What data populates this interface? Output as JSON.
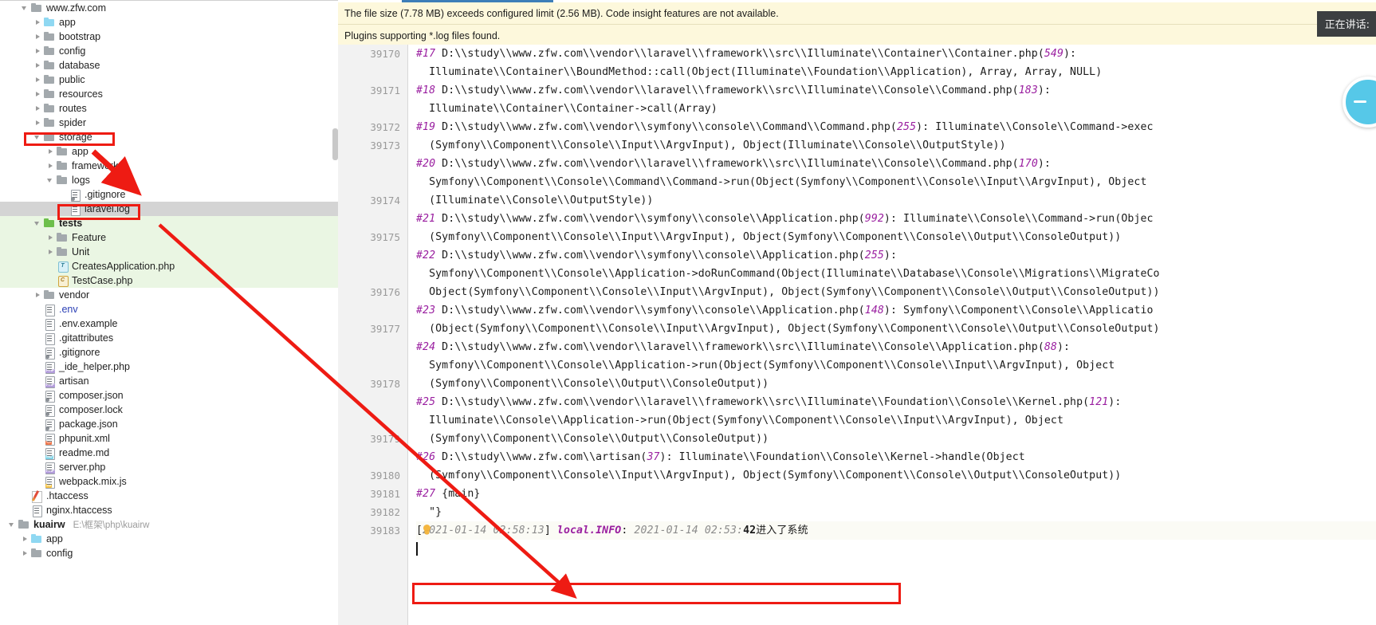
{
  "project_tree": {
    "rows": [
      {
        "indent": 0,
        "arrow": "open",
        "icon": "folder",
        "label": "www.zfw.com",
        "style": "normal"
      },
      {
        "indent": 1,
        "arrow": "closed",
        "icon": "folder-blue",
        "label": "app",
        "style": "normal"
      },
      {
        "indent": 1,
        "arrow": "closed",
        "icon": "folder",
        "label": "bootstrap",
        "style": "normal"
      },
      {
        "indent": 1,
        "arrow": "closed",
        "icon": "folder",
        "label": "config",
        "style": "normal"
      },
      {
        "indent": 1,
        "arrow": "closed",
        "icon": "folder",
        "label": "database",
        "style": "normal"
      },
      {
        "indent": 1,
        "arrow": "closed",
        "icon": "folder",
        "label": "public",
        "style": "normal"
      },
      {
        "indent": 1,
        "arrow": "closed",
        "icon": "folder",
        "label": "resources",
        "style": "normal"
      },
      {
        "indent": 1,
        "arrow": "closed",
        "icon": "folder",
        "label": "routes",
        "style": "normal"
      },
      {
        "indent": 1,
        "arrow": "closed",
        "icon": "folder",
        "label": "spider",
        "style": "normal"
      },
      {
        "indent": 1,
        "arrow": "open",
        "icon": "folder",
        "label": "storage",
        "style": "normal"
      },
      {
        "indent": 2,
        "arrow": "closed",
        "icon": "folder",
        "label": "app",
        "style": "normal"
      },
      {
        "indent": 2,
        "arrow": "closed",
        "icon": "folder",
        "label": "framework",
        "style": "normal"
      },
      {
        "indent": 2,
        "arrow": "open",
        "icon": "folder",
        "label": "logs",
        "style": "normal"
      },
      {
        "indent": 3,
        "arrow": "none",
        "icon": "file-cfg",
        "label": ".gitignore",
        "style": "normal"
      },
      {
        "indent": 3,
        "arrow": "none",
        "icon": "file",
        "label": "laravel.log",
        "style": "selected"
      },
      {
        "indent": 1,
        "arrow": "open",
        "icon": "folder-green",
        "label": "tests",
        "style": "bold-green"
      },
      {
        "indent": 2,
        "arrow": "closed",
        "icon": "folder",
        "label": "Feature",
        "style": "green"
      },
      {
        "indent": 2,
        "arrow": "closed",
        "icon": "folder",
        "label": "Unit",
        "style": "green"
      },
      {
        "indent": 2,
        "arrow": "none",
        "icon": "trait",
        "label": "CreatesApplication.php",
        "style": "green"
      },
      {
        "indent": 2,
        "arrow": "none",
        "icon": "class",
        "label": "TestCase.php",
        "style": "green"
      },
      {
        "indent": 1,
        "arrow": "closed",
        "icon": "folder",
        "label": "vendor",
        "style": "normal"
      },
      {
        "indent": 1,
        "arrow": "none",
        "icon": "file",
        "label": ".env",
        "style": "blue"
      },
      {
        "indent": 1,
        "arrow": "none",
        "icon": "file",
        "label": ".env.example",
        "style": "normal"
      },
      {
        "indent": 1,
        "arrow": "none",
        "icon": "file",
        "label": ".gitattributes",
        "style": "normal"
      },
      {
        "indent": 1,
        "arrow": "none",
        "icon": "file-cfg",
        "label": ".gitignore",
        "style": "normal"
      },
      {
        "indent": 1,
        "arrow": "none",
        "icon": "file-php",
        "label": "_ide_helper.php",
        "style": "normal"
      },
      {
        "indent": 1,
        "arrow": "none",
        "icon": "file-php",
        "label": "artisan",
        "style": "normal"
      },
      {
        "indent": 1,
        "arrow": "none",
        "icon": "file-cfg",
        "label": "composer.json",
        "style": "normal"
      },
      {
        "indent": 1,
        "arrow": "none",
        "icon": "file-cfg",
        "label": "composer.lock",
        "style": "normal"
      },
      {
        "indent": 1,
        "arrow": "none",
        "icon": "file-cfg",
        "label": "package.json",
        "style": "normal"
      },
      {
        "indent": 1,
        "arrow": "none",
        "icon": "file-xml",
        "label": "phpunit.xml",
        "style": "normal"
      },
      {
        "indent": 1,
        "arrow": "none",
        "icon": "file-md",
        "label": "readme.md",
        "style": "normal"
      },
      {
        "indent": 1,
        "arrow": "none",
        "icon": "file-php",
        "label": "server.php",
        "style": "normal"
      },
      {
        "indent": 1,
        "arrow": "none",
        "icon": "file-js",
        "label": "webpack.mix.js",
        "style": "normal"
      },
      {
        "indent": 0,
        "arrow": "none",
        "icon": "file-pen",
        "label": ".htaccess",
        "style": "normal"
      },
      {
        "indent": 0,
        "arrow": "none",
        "icon": "file",
        "label": "nginx.htaccess",
        "style": "normal"
      },
      {
        "indent": -1,
        "arrow": "open",
        "icon": "folder",
        "label": "kuairw",
        "style": "bold",
        "path": "E:\\框架\\php\\kuairw"
      },
      {
        "indent": 0,
        "arrow": "closed",
        "icon": "folder-blue",
        "label": "app",
        "style": "normal"
      },
      {
        "indent": 0,
        "arrow": "closed",
        "icon": "folder",
        "label": "config",
        "style": "normal"
      }
    ]
  },
  "notifications": [
    {
      "text": "The file size (7.78 MB) exceeds configured limit (2.56 MB). Code insight features are not available."
    },
    {
      "text": "Plugins supporting *.log files found."
    }
  ],
  "speaking_badge": {
    "label": "正在讲话:"
  },
  "editor": {
    "gutter_numbers": [
      "39170",
      "",
      "39171",
      "",
      "39172",
      "39173",
      "",
      "",
      "39174",
      "",
      "39175",
      "",
      "",
      "39176",
      "",
      "39177",
      "",
      "",
      "39178",
      "",
      "",
      "39179",
      "",
      "39180",
      "39181",
      "39182",
      "39183"
    ],
    "lines": [
      {
        "type": "frame",
        "frame": "#17",
        "text": " D:\\\\study\\\\www.zfw.com\\\\vendor\\\\laravel\\\\framework\\\\src\\\\Illuminate\\\\Container\\\\Container.php(",
        "paren": "549",
        "tail": "):"
      },
      {
        "type": "cont",
        "text": "  Illuminate\\\\Container\\\\BoundMethod::call(Object(Illuminate\\\\Foundation\\\\Application), Array, Array, NULL)"
      },
      {
        "type": "frame",
        "frame": "#18",
        "text": " D:\\\\study\\\\www.zfw.com\\\\vendor\\\\laravel\\\\framework\\\\src\\\\Illuminate\\\\Console\\\\Command.php(",
        "paren": "183",
        "tail": "):"
      },
      {
        "type": "cont",
        "text": "  Illuminate\\\\Container\\\\Container->call(Array)"
      },
      {
        "type": "frame",
        "frame": "#19",
        "text": " D:\\\\study\\\\www.zfw.com\\\\vendor\\\\symfony\\\\console\\\\Command\\\\Command.php(",
        "paren": "255",
        "tail": "): Illuminate\\\\Console\\\\Command->exec"
      },
      {
        "type": "cont",
        "text": "  (Symfony\\\\Component\\\\Console\\\\Input\\\\ArgvInput), Object(Illuminate\\\\Console\\\\OutputStyle))"
      },
      {
        "type": "frame",
        "frame": "#20",
        "text": " D:\\\\study\\\\www.zfw.com\\\\vendor\\\\laravel\\\\framework\\\\src\\\\Illuminate\\\\Console\\\\Command.php(",
        "paren": "170",
        "tail": "):"
      },
      {
        "type": "cont",
        "text": "  Symfony\\\\Component\\\\Console\\\\Command\\\\Command->run(Object(Symfony\\\\Component\\\\Console\\\\Input\\\\ArgvInput), Object"
      },
      {
        "type": "cont",
        "text": "  (Illuminate\\\\Console\\\\OutputStyle))"
      },
      {
        "type": "frame",
        "frame": "#21",
        "text": " D:\\\\study\\\\www.zfw.com\\\\vendor\\\\symfony\\\\console\\\\Application.php(",
        "paren": "992",
        "tail": "): Illuminate\\\\Console\\\\Command->run(Objec"
      },
      {
        "type": "cont",
        "text": "  (Symfony\\\\Component\\\\Console\\\\Input\\\\ArgvInput), Object(Symfony\\\\Component\\\\Console\\\\Output\\\\ConsoleOutput))"
      },
      {
        "type": "frame",
        "frame": "#22",
        "text": " D:\\\\study\\\\www.zfw.com\\\\vendor\\\\symfony\\\\console\\\\Application.php(",
        "paren": "255",
        "tail": "):"
      },
      {
        "type": "cont",
        "text": "  Symfony\\\\Component\\\\Console\\\\Application->doRunCommand(Object(Illuminate\\\\Database\\\\Console\\\\Migrations\\\\MigrateCo"
      },
      {
        "type": "cont",
        "text": "  Object(Symfony\\\\Component\\\\Console\\\\Input\\\\ArgvInput), Object(Symfony\\\\Component\\\\Console\\\\Output\\\\ConsoleOutput))"
      },
      {
        "type": "frame",
        "frame": "#23",
        "text": " D:\\\\study\\\\www.zfw.com\\\\vendor\\\\symfony\\\\console\\\\Application.php(",
        "paren": "148",
        "tail": "): Symfony\\\\Component\\\\Console\\\\Applicatio"
      },
      {
        "type": "cont",
        "text": "  (Object(Symfony\\\\Component\\\\Console\\\\Input\\\\ArgvInput), Object(Symfony\\\\Component\\\\Console\\\\Output\\\\ConsoleOutput)"
      },
      {
        "type": "frame",
        "frame": "#24",
        "text": " D:\\\\study\\\\www.zfw.com\\\\vendor\\\\laravel\\\\framework\\\\src\\\\Illuminate\\\\Console\\\\Application.php(",
        "paren": "88",
        "tail": "):"
      },
      {
        "type": "cont",
        "text": "  Symfony\\\\Component\\\\Console\\\\Application->run(Object(Symfony\\\\Component\\\\Console\\\\Input\\\\ArgvInput), Object"
      },
      {
        "type": "cont",
        "text": "  (Symfony\\\\Component\\\\Console\\\\Output\\\\ConsoleOutput))"
      },
      {
        "type": "frame",
        "frame": "#25",
        "text": " D:\\\\study\\\\www.zfw.com\\\\vendor\\\\laravel\\\\framework\\\\src\\\\Illuminate\\\\Foundation\\\\Console\\\\Kernel.php(",
        "paren": "121",
        "tail": "):"
      },
      {
        "type": "cont",
        "text": "  Illuminate\\\\Console\\\\Application->run(Object(Symfony\\\\Component\\\\Console\\\\Input\\\\ArgvInput), Object"
      },
      {
        "type": "cont",
        "text": "  (Symfony\\\\Component\\\\Console\\\\Output\\\\ConsoleOutput))"
      },
      {
        "type": "frame",
        "frame": "#26",
        "text": " D:\\\\study\\\\www.zfw.com\\\\artisan(",
        "paren": "37",
        "tail": "): Illuminate\\\\Foundation\\\\Console\\\\Kernel->handle(Object"
      },
      {
        "type": "cont",
        "text": "  (Symfony\\\\Component\\\\Console\\\\Input\\\\ArgvInput), Object(Symfony\\\\Component\\\\Console\\\\Output\\\\ConsoleOutput))"
      },
      {
        "type": "frame",
        "frame": "#27",
        "text": " {main}",
        "paren": "",
        "tail": ""
      },
      {
        "type": "cont",
        "text": "  \"}"
      },
      {
        "type": "log",
        "bracket_open": "[",
        "timestamp": "2021-01-14 02:58:13",
        "bracket_close": "] ",
        "level": "local.INFO",
        "colon": ": ",
        "message": "2021-01-14 02:53:",
        "msgbold": "42",
        "chinese": "进入了系统"
      },
      {
        "type": "empty",
        "text": ""
      }
    ]
  },
  "colors": {
    "annotation_red": "#ee1b13",
    "notification_bg": "#fdf8dc",
    "selection_gray": "#d4d4d4",
    "tests_green": "#eaf6e3",
    "tab_accent": "#3d7eb8",
    "number_purple": "#9a1fa0",
    "orb_blue": "#56c8e8"
  }
}
